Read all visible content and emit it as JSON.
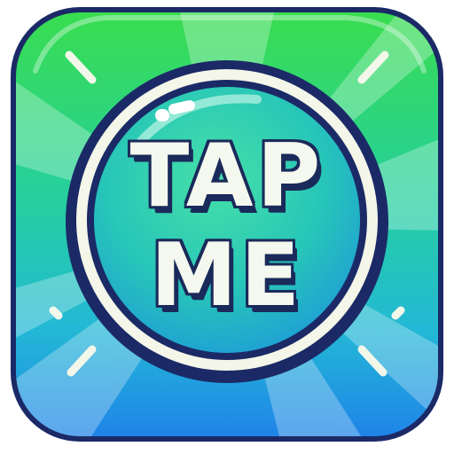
{
  "button": {
    "line1": "TAP",
    "line2": "ME"
  },
  "icons": {
    "app_icon": "tap-me-app-icon",
    "tap_button": "round-tap-button"
  },
  "colors": {
    "frame_outline": "#1b2a66",
    "bg_top": "#2fd45a",
    "bg_mid": "#22c9a8",
    "bg_bottom": "#1f8fe6",
    "button_top": "#36d8a0",
    "button_bottom": "#1da8d8",
    "button_ring": "#f3f6e8",
    "text_fill": "#f4f8ee"
  }
}
